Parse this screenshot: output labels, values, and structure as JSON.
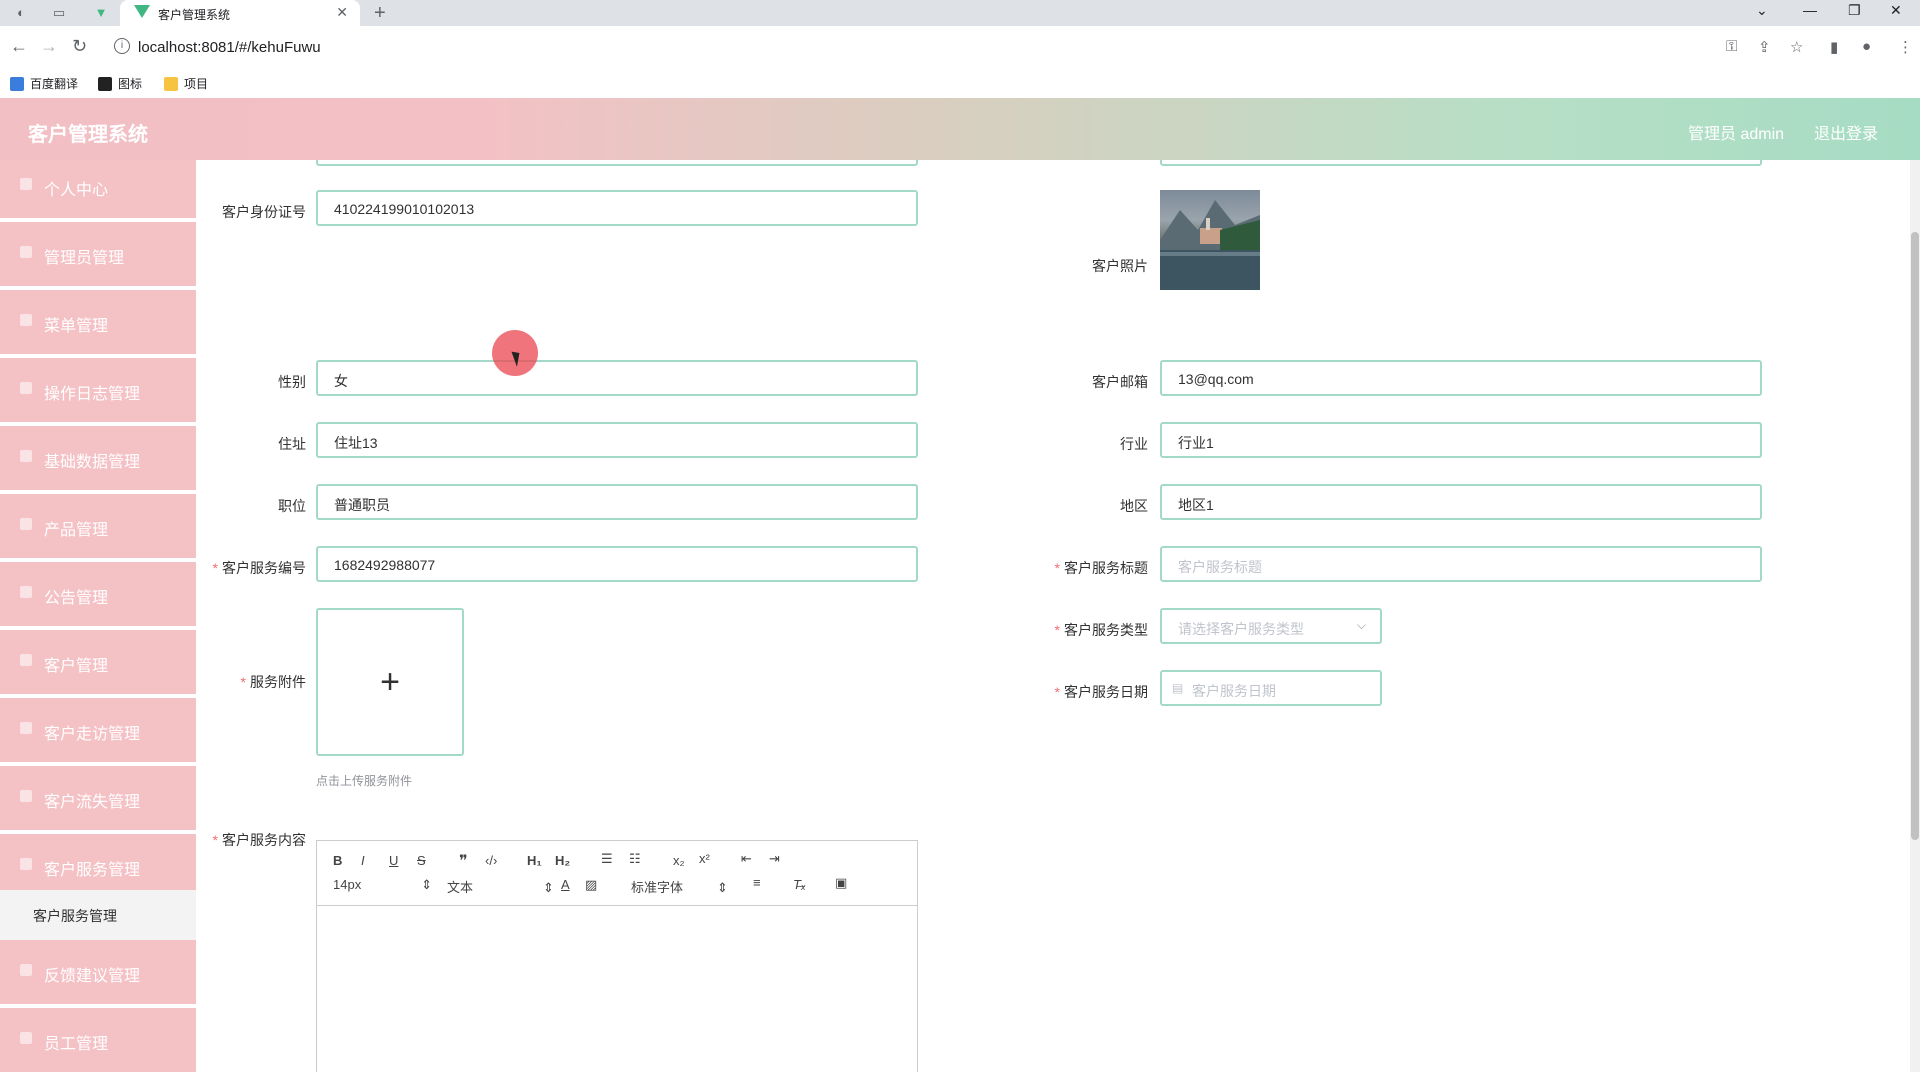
{
  "browser": {
    "tab_title": "客户管理系统",
    "url": "localhost:8081/#/kehuFuwu",
    "bookmarks": [
      "百度翻译",
      "图标",
      "项目"
    ]
  },
  "header": {
    "title": "客户管理系统",
    "user": "管理员 admin",
    "logout": "退出登录"
  },
  "sidebar": {
    "items": [
      {
        "label": "个人中心"
      },
      {
        "label": "管理员管理"
      },
      {
        "label": "菜单管理"
      },
      {
        "label": "操作日志管理"
      },
      {
        "label": "基础数据管理"
      },
      {
        "label": "产品管理"
      },
      {
        "label": "公告管理"
      },
      {
        "label": "客户管理"
      },
      {
        "label": "客户走访管理"
      },
      {
        "label": "客户流失管理"
      },
      {
        "label": "客户服务管理"
      },
      {
        "label": "反馈建议管理"
      },
      {
        "label": "员工管理"
      }
    ],
    "active_sub": "客户服务管理"
  },
  "form": {
    "id_card": {
      "label": "客户身份证号",
      "value": "410224199010102013"
    },
    "photo": {
      "label": "客户照片"
    },
    "gender": {
      "label": "性别",
      "value": "女"
    },
    "email": {
      "label": "客户邮箱",
      "value": "13@qq.com"
    },
    "address": {
      "label": "住址",
      "value": "住址13"
    },
    "industry": {
      "label": "行业",
      "value": "行业1"
    },
    "position": {
      "label": "职位",
      "value": "普通职员"
    },
    "region": {
      "label": "地区",
      "value": "地区1"
    },
    "service_no": {
      "label": "客户服务编号",
      "value": "1682492988077"
    },
    "service_title": {
      "label": "客户服务标题",
      "placeholder": "客户服务标题"
    },
    "attachment": {
      "label": "服务附件",
      "hint": "点击上传服务附件"
    },
    "service_type": {
      "label": "客户服务类型",
      "placeholder": "请选择客户服务类型"
    },
    "service_date": {
      "label": "客户服务日期",
      "placeholder": "客户服务日期"
    },
    "content": {
      "label": "客户服务内容"
    }
  },
  "editor": {
    "font_size": "14px",
    "text_style": "文本",
    "font_family": "标准字体"
  },
  "colors": {
    "sidebar": "#f4c1c5",
    "input_border": "#a3d9c8",
    "required": "#f56c6c"
  }
}
